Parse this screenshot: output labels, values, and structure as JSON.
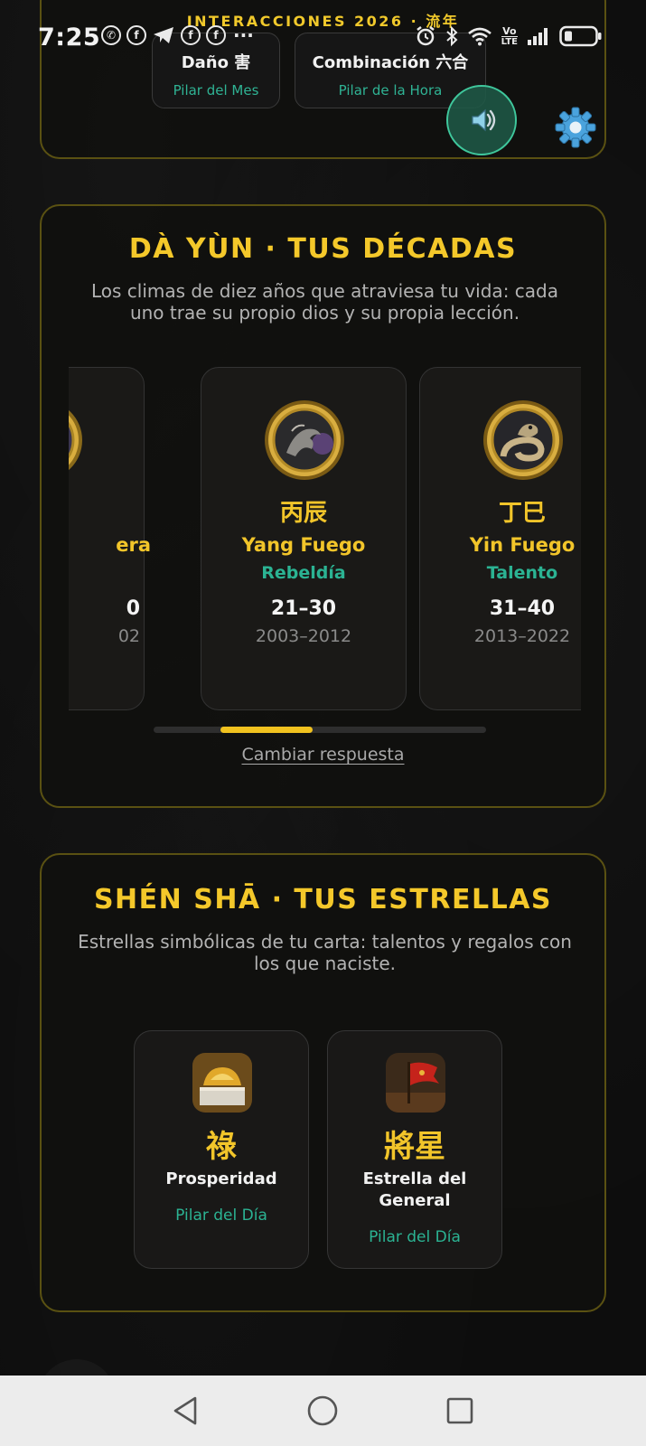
{
  "status_bar": {
    "time": "7:25",
    "app_icons": [
      "whatsapp-icon",
      "facebook-icon",
      "telegram-icon",
      "facebook-icon",
      "facebook-icon"
    ],
    "more": "···",
    "right_icons": [
      "alarm-icon",
      "bluetooth-icon",
      "wifi-icon",
      "volte-icon",
      "signal-icon",
      "battery-icon"
    ],
    "volte_top": "Vo",
    "volte_bottom": "LTE"
  },
  "banner": "INTERACCIONES 2026 · 流年",
  "top_chips": [
    {
      "title": "Daño 害",
      "sub": "Pilar del Mes"
    },
    {
      "title": "Combinación 六合",
      "sub": "Pilar de la Hora"
    }
  ],
  "dayun": {
    "title": "DÀ YÙN · TUS DÉCADAS",
    "description": "Los climas de diez años que atraviesa tu vida: cada uno trae su propio dios y su propia lección.",
    "decades": [
      {
        "pillar": "",
        "element": "era",
        "theme": "",
        "ages": "0",
        "years": "02",
        "animal": "dragon"
      },
      {
        "pillar": "丙辰",
        "element": "Yang Fuego",
        "theme": "Rebeldía",
        "ages": "21–30",
        "years": "2003–2012",
        "animal": "dragon"
      },
      {
        "pillar": "丁巳",
        "element": "Yin Fuego",
        "theme": "Talento",
        "ages": "31–40",
        "years": "2013–2022",
        "animal": "snake"
      }
    ],
    "scroll_position": 0.2,
    "change_link": "Cambiar respuesta"
  },
  "shensha": {
    "title": "SHÉN SHĀ · TUS ESTRELLAS",
    "description": "Estrellas simbólicas de tu carta: talentos y regalos con los que naciste.",
    "stars": [
      {
        "glyph": "祿",
        "name": "Prosperidad",
        "pillar": "Pilar del Día",
        "icon": "gold-ingot-icon"
      },
      {
        "glyph": "將星",
        "name": "Estrella del General",
        "pillar": "Pilar del Día",
        "icon": "red-flag-icon"
      }
    ]
  },
  "colors": {
    "gold": "#f2c52a",
    "teal": "#2bb393",
    "card_border": "#5a5112",
    "background": "#0d0d0d"
  },
  "nav": [
    "back-icon",
    "home-icon",
    "recents-icon"
  ]
}
